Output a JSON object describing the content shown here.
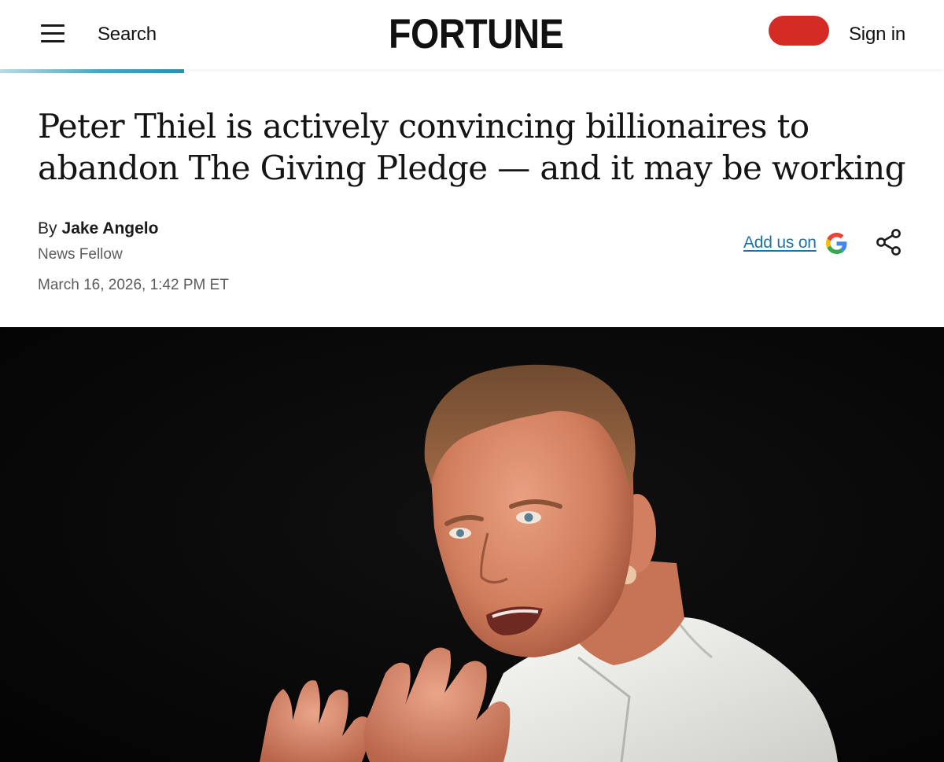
{
  "header": {
    "menu_icon": "hamburger-menu-icon",
    "search_label": "Search",
    "logo_text": "FORTUNE",
    "signin_label": "Sign in",
    "accent_color": "#d42b25"
  },
  "reading_progress": {
    "fraction": 0.195,
    "color": "#2f8db4"
  },
  "article": {
    "headline": "Peter Thiel is actively convincing billionaires to abandon The Giving Pledge — and it may be working",
    "byline_prefix": "By",
    "author": "Jake Angelo",
    "author_role": "News Fellow",
    "published": "March 16, 2026, 1:42 PM ET",
    "add_google_label": "Add us on",
    "add_google_icon": "google-g-icon",
    "share_icon": "share-icon"
  },
  "hero_image": {
    "subject": "photo-of-man-in-white-shirt-gesturing"
  }
}
